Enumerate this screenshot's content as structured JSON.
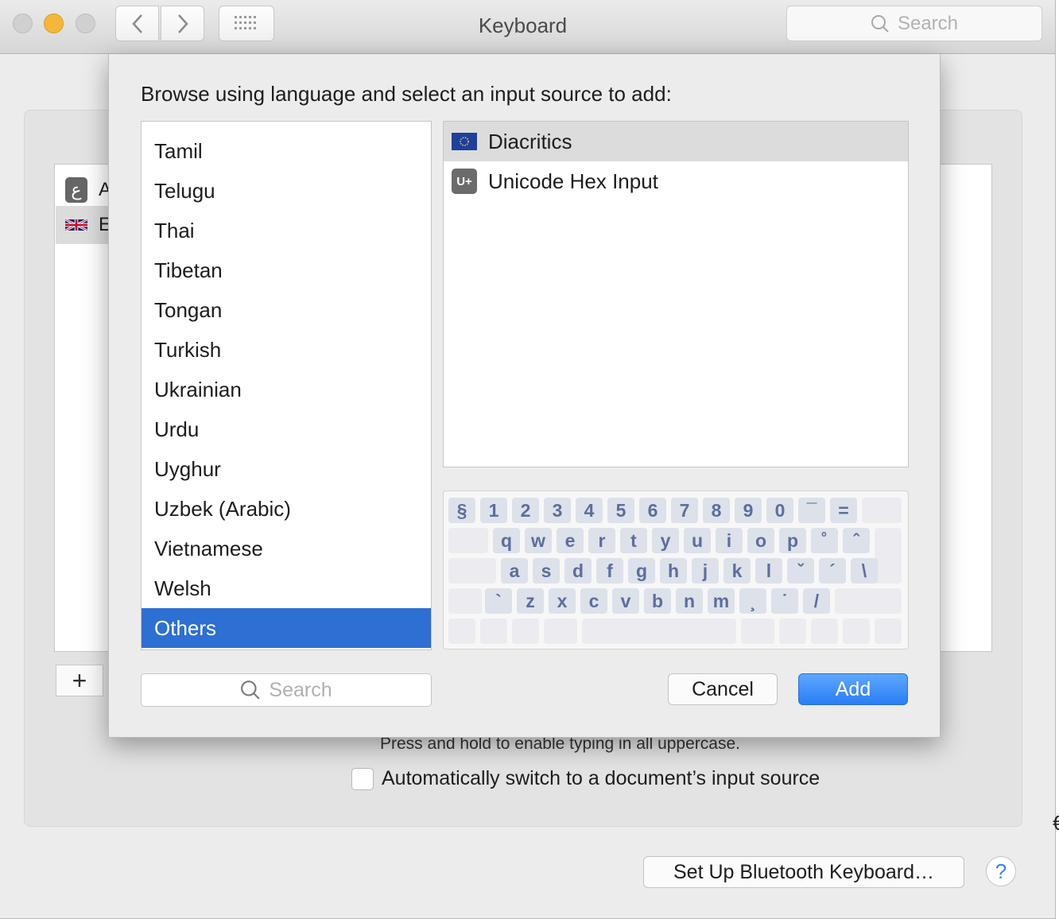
{
  "window": {
    "title": "Keyboard",
    "search_placeholder": "Search"
  },
  "background": {
    "input_sources": [
      {
        "icon": "arabic-input-icon",
        "glyph": "ع",
        "label_partial": "A"
      },
      {
        "icon": "uk-flag-icon",
        "label_partial": "E"
      }
    ],
    "add_label": "+",
    "caps_hint": "Press and hold to enable typing in all uppercase.",
    "auto_switch_label": "Automatically switch to a document’s input source",
    "auto_switch_checked": false,
    "bluetooth_button": "Set Up Bluetooth Keyboard…",
    "help_label": "?",
    "edge_glyph": "€"
  },
  "sheet": {
    "title": "Browse using language and select an input source to add:",
    "languages": [
      "Tamil",
      "Telugu",
      "Thai",
      "Tibetan",
      "Tongan",
      "Turkish",
      "Ukrainian",
      "Urdu",
      "Uyghur",
      "Uzbek (Arabic)",
      "Vietnamese",
      "Welsh",
      "Others"
    ],
    "selected_language": "Others",
    "sources": [
      {
        "label": "Diacritics",
        "icon": "diacritics-flag-icon",
        "highlighted": true
      },
      {
        "label": "Unicode Hex Input",
        "icon": "unicode-hex-icon",
        "icon_text": "U+",
        "highlighted": false
      }
    ],
    "keyboard_rows": [
      [
        "§",
        "1",
        "2",
        "3",
        "4",
        "5",
        "6",
        "7",
        "8",
        "9",
        "0",
        "¯",
        "="
      ],
      [
        "q",
        "w",
        "e",
        "r",
        "t",
        "y",
        "u",
        "i",
        "o",
        "p",
        "˚",
        "ˆ"
      ],
      [
        "a",
        "s",
        "d",
        "f",
        "g",
        "h",
        "j",
        "k",
        "l",
        "ˇ",
        "´",
        "\\"
      ],
      [
        "`",
        "z",
        "x",
        "c",
        "v",
        "b",
        "n",
        "m",
        "¸",
        "˙",
        "/"
      ]
    ],
    "search_placeholder": "Search",
    "cancel_label": "Cancel",
    "add_label": "Add"
  },
  "colors": {
    "selection": "#2d6fd2",
    "accent_button": "#2a7ef4",
    "key_text": "#5d6e9c"
  }
}
